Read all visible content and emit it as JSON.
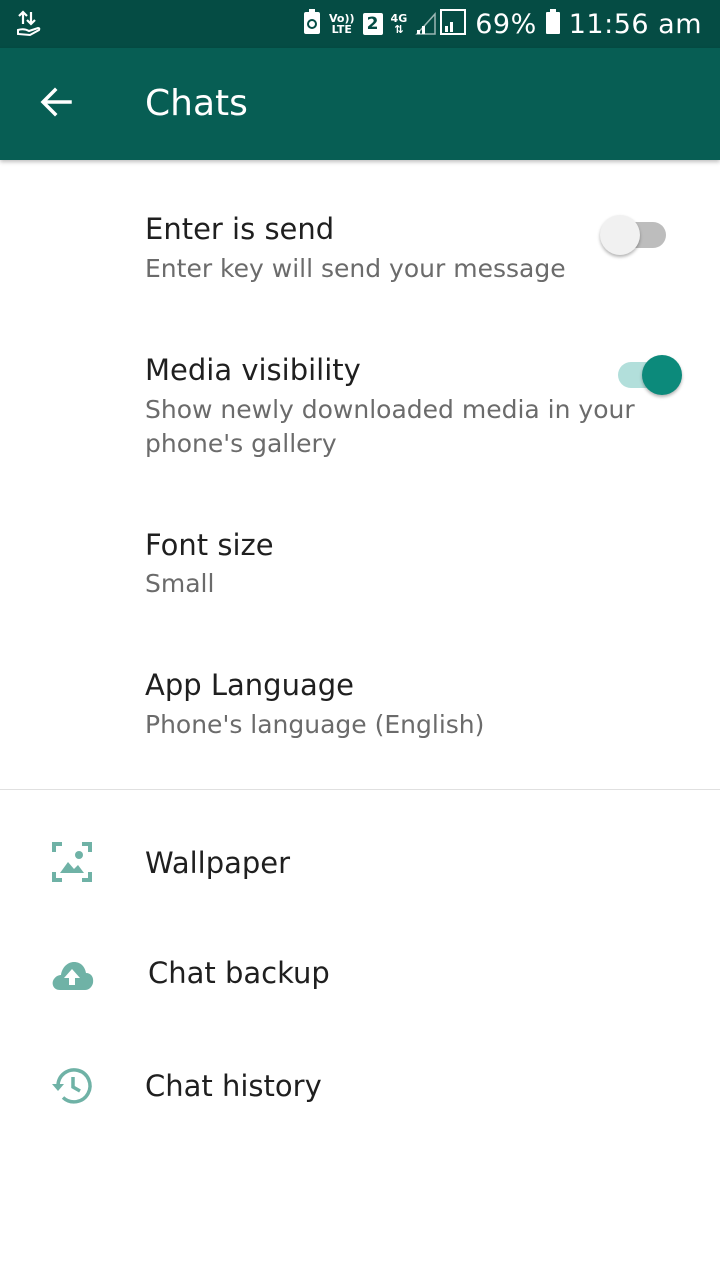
{
  "status_bar": {
    "volte_top": "Vo))",
    "volte_bottom": "LTE",
    "sim_slot": "2",
    "network": "4G",
    "battery_percent": "69%",
    "time": "11:56 am",
    "icons": [
      "data-transfer-icon",
      "battery-saver-icon",
      "signal-icon",
      "battery-icon"
    ]
  },
  "app_bar": {
    "title": "Chats",
    "back_icon": "arrow-left-icon",
    "background": "#075e54"
  },
  "settings": {
    "enter_is_send": {
      "title": "Enter is send",
      "subtitle": "Enter key will send your message",
      "enabled": false
    },
    "media_visibility": {
      "title": "Media visibility",
      "subtitle_line1": "Show newly downloaded media in your",
      "subtitle_line2": "phone's gallery",
      "enabled": true
    },
    "font_size": {
      "title": "Font size",
      "value": "Small"
    },
    "app_language": {
      "title": "App Language",
      "value": "Phone's language (English)"
    }
  },
  "links": {
    "wallpaper": {
      "label": "Wallpaper",
      "icon": "wallpaper-icon"
    },
    "chat_backup": {
      "label": "Chat backup",
      "icon": "cloud-upload-icon"
    },
    "chat_history": {
      "label": "Chat history",
      "icon": "history-icon"
    }
  },
  "colors": {
    "accent": "#0c8a7b",
    "icon_tint": "#6fb2a6",
    "status_bar": "#054c44"
  }
}
